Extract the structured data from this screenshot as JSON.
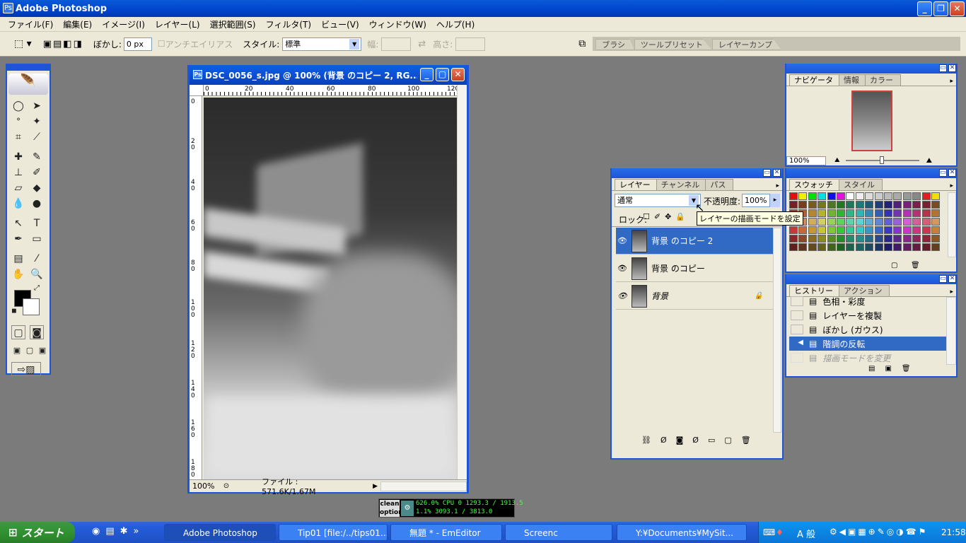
{
  "app": {
    "title": "Adobe Photoshop"
  },
  "menu": [
    "ファイル(F)",
    "編集(E)",
    "イメージ(I)",
    "レイヤー(L)",
    "選択範囲(S)",
    "フィルタ(T)",
    "ビュー(V)",
    "ウィンドウ(W)",
    "ヘルプ(H)"
  ],
  "options": {
    "feather_label": "ぼかし:",
    "feather_value": "0 px",
    "antialias_label": "アンチエイリアス",
    "style_label": "スタイル:",
    "style_value": "標準",
    "width_label": "幅:",
    "height_label": "高さ:",
    "palette_tabs": [
      "ブラシ",
      "ツールプリセット",
      "レイヤーカンプ"
    ]
  },
  "document": {
    "title": "DSC_0056_s.jpg @ 100% (背景 のコピー 2, RG...",
    "zoom": "100%",
    "file_info": "ファイル : 571.6K/1.67M",
    "hruler_ticks": [
      "0",
      "20",
      "40",
      "60",
      "80",
      "100",
      "120"
    ],
    "vruler_ticks": [
      "0",
      "2\n0",
      "4\n0",
      "6\n0",
      "8\n0",
      "1\n0\n0",
      "1\n2\n0",
      "1\n4\n0",
      "1\n6\n0",
      "1\n8\n0"
    ]
  },
  "navigator": {
    "tabs": [
      "ナビゲータ",
      "情報",
      "カラー"
    ],
    "zoom": "100%"
  },
  "layers": {
    "tabs": [
      "レイヤー",
      "チャンネル",
      "パス"
    ],
    "blend_mode": "通常",
    "opacity_label": "不透明度:",
    "opacity_value": "100%",
    "lock_label": "ロック:",
    "tooltip": "レイヤーの描画モードを設定",
    "items": [
      {
        "name": "背景 のコピー 2",
        "selected": true
      },
      {
        "name": "背景 のコピー",
        "selected": false
      },
      {
        "name": "背景",
        "selected": false,
        "locked": true
      }
    ]
  },
  "swatches": {
    "tabs": [
      "スウォッチ",
      "スタイル"
    ]
  },
  "history": {
    "tabs": [
      "ヒストリー",
      "アクション"
    ],
    "items": [
      {
        "name": "色相・彩度",
        "state": "normal"
      },
      {
        "name": "レイヤーを複製",
        "state": "normal"
      },
      {
        "name": "ぼかし (ガウス)",
        "state": "normal"
      },
      {
        "name": "階調の反転",
        "state": "selected"
      },
      {
        "name": "描画モードを変更",
        "state": "dimmed"
      }
    ]
  },
  "cleanwidget": {
    "line1": "clean",
    "line2": "option",
    "cpu": "626.0% CPU",
    "stats1": "0 1293.3 / 1913.5",
    "stats2": "1.1% 3093.1 / 3813.0"
  },
  "taskbar": {
    "start": "スタート",
    "tasks": [
      {
        "label": "Adobe Photoshop",
        "active": true
      },
      {
        "label": "Tip01 [file:/../tips01...",
        "active": false
      },
      {
        "label": "無題 * - EmEditor",
        "active": false
      },
      {
        "label": "Screenc",
        "active": false
      },
      {
        "label": "Y:¥Documents¥MySit...",
        "active": false
      }
    ],
    "ime": "A 般",
    "clock": "21:58"
  },
  "colors": {
    "titlebar": "#0044cc",
    "selection": "#316ac5",
    "panel_bg": "#ece9d8",
    "desktop": "#7b7b7b"
  }
}
